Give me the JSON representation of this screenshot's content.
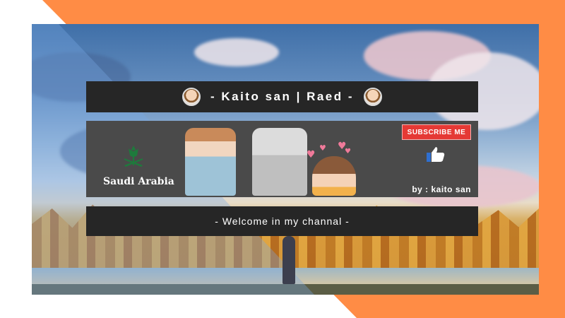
{
  "banner": {
    "title": "- Kaito san | Raed -",
    "country": "Saudi Arabia",
    "subscribe_label": "SUBSCRIBE ME",
    "byline": "by : kaito san",
    "welcome": "- Welcome in my channal -"
  },
  "icons": [
    "avatar-icon",
    "saudi-emblem-icon",
    "thumbs-up-icon",
    "heart-icon"
  ],
  "colors": {
    "frame_orange": "#ff8c45",
    "strip_dark": "#262626",
    "mid_strip": "#4a4a4a",
    "subscribe_red": "#e53935",
    "emblem_green": "#1e7a3c"
  }
}
